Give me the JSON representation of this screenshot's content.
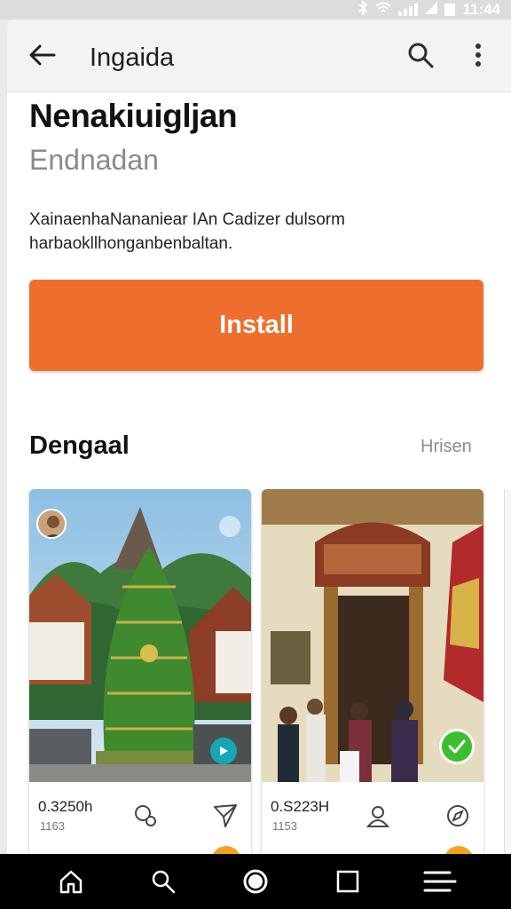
{
  "status_bar": {
    "time": "11:44"
  },
  "toolbar": {
    "title": "Ingaida"
  },
  "app": {
    "name": "Nenakiuigljan",
    "subtitle": "Endnadan",
    "description": "XainaenhaNananiear IAn Cadizer dulsorm harbaokllhonganbenbaltan.",
    "install_label": "Install",
    "accent_color": "#ee6f2d"
  },
  "section": {
    "title": "Dengaal",
    "link": "Hrisen"
  },
  "cards": [
    {
      "value": "0.3250h",
      "count": "1163",
      "action_icons": [
        "reactions-icon",
        "send-icon"
      ],
      "overlay_icons": [
        "avatar",
        "bookmark-icon",
        "play-icon"
      ]
    },
    {
      "value": "0.S223H",
      "count": "1153",
      "action_icons": [
        "user-add-icon",
        "compass-icon"
      ],
      "overlay_icons": [
        "verified-check-icon"
      ]
    }
  ],
  "nav": {
    "items": [
      "home-icon",
      "search-icon",
      "circle-icon",
      "square-icon",
      "menu-icon"
    ]
  }
}
